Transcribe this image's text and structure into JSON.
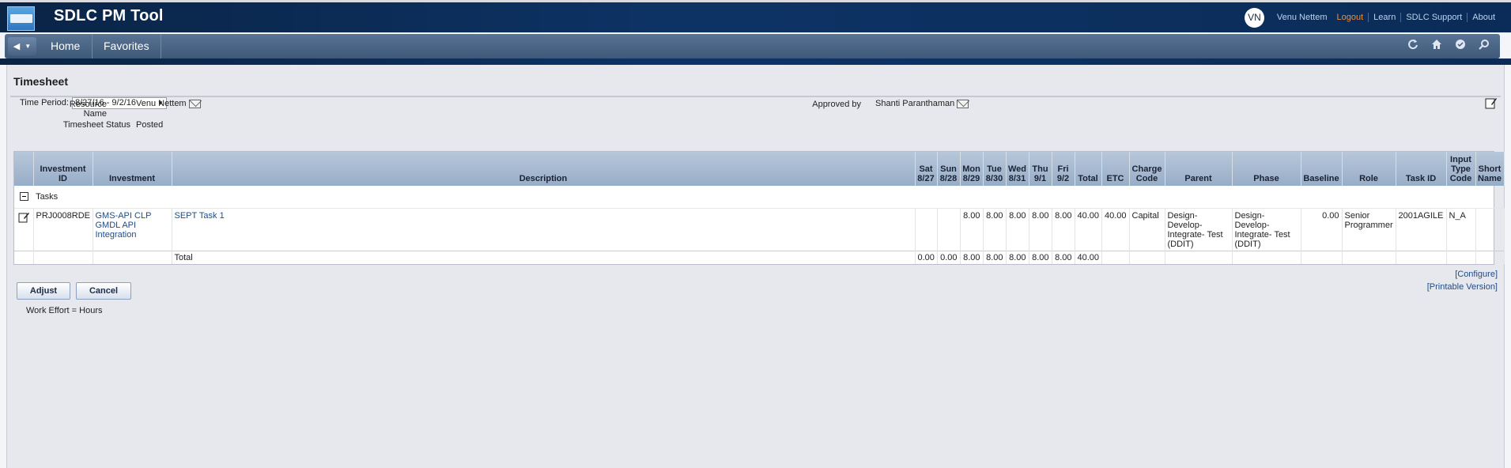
{
  "app": {
    "title": "SDLC PM Tool"
  },
  "user": {
    "initials": "VN",
    "name": "Venu Nettem",
    "links": [
      "Logout",
      "Learn",
      "SDLC Support",
      "About"
    ]
  },
  "nav": {
    "home": "Home",
    "favorites": "Favorites"
  },
  "page": {
    "title": "Timesheet",
    "time_period_label": "Time Period:",
    "time_period_value": "8/27/16 - 9/2/16",
    "resource_name_label": "Resource Name",
    "resource_name_value": "Venu Nettem",
    "status_label": "Timesheet Status",
    "status_value": "Posted",
    "approved_by_label": "Approved by",
    "approved_by_value": "Shanti Paranthaman"
  },
  "grid": {
    "headers": {
      "investment_id": "Investment ID",
      "investment": "Investment",
      "description": "Description",
      "sat": "Sat 8/27",
      "sun": "Sun 8/28",
      "mon": "Mon 8/29",
      "tue": "Tue 8/30",
      "wed": "Wed 8/31",
      "thu": "Thu 9/1",
      "fri": "Fri 9/2",
      "total": "Total",
      "etc": "ETC",
      "charge_code": "Charge Code",
      "parent": "Parent",
      "phase": "Phase",
      "baseline": "Baseline",
      "role": "Role",
      "task_id": "Task ID",
      "input_type_code": "Input Type Code",
      "short_name": "Short Name"
    },
    "group_label": "Tasks",
    "row": {
      "investment_id": "PRJ0008RDE",
      "investment": "GMS-API CLP GMDL API Integration",
      "description": "SEPT Task 1",
      "sat": "",
      "sun": "",
      "mon": "8.00",
      "tue": "8.00",
      "wed": "8.00",
      "thu": "8.00",
      "fri": "8.00",
      "total": "40.00",
      "etc": "40.00",
      "charge_code": "Capital",
      "parent": "Design-Develop-Integrate- Test (DDIT)",
      "phase": "Design-Develop-Integrate- Test (DDIT)",
      "baseline": "0.00",
      "role": "Senior Programmer",
      "task_id": "2001AGILE",
      "input_type_code": "N_A",
      "short_name": ""
    },
    "totals": {
      "label": "Total",
      "sat": "0.00",
      "sun": "0.00",
      "mon": "8.00",
      "tue": "8.00",
      "wed": "8.00",
      "thu": "8.00",
      "fri": "8.00",
      "total": "40.00"
    }
  },
  "actions": {
    "adjust": "Adjust",
    "cancel": "Cancel",
    "configure": "[Configure]",
    "printable": "[Printable Version]"
  },
  "footer_note": "Work Effort = Hours"
}
